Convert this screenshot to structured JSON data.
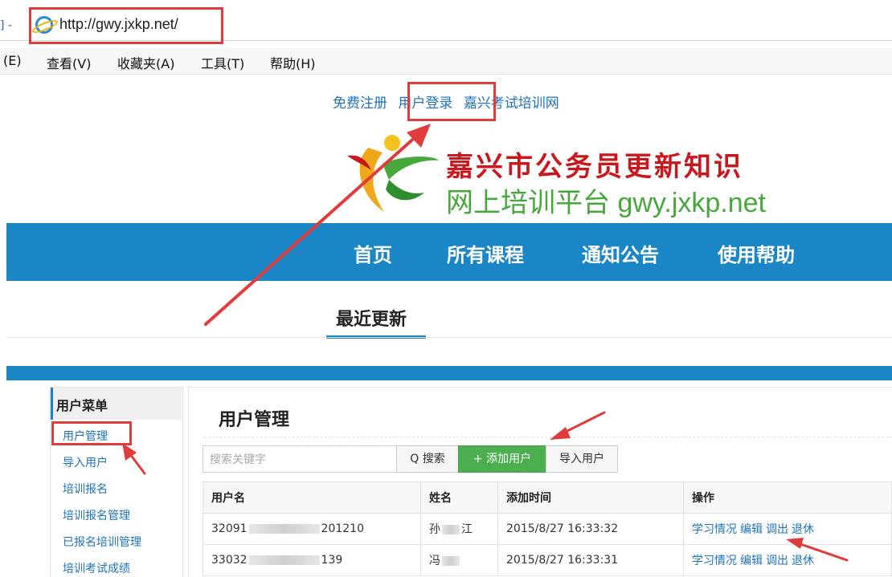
{
  "browser": {
    "nav_prefix": "] -",
    "url": "http://gwy.jxkp.net/",
    "menu": [
      "(E)",
      "查看(V)",
      "收藏夹(A)",
      "工具(T)",
      "帮助(H)"
    ]
  },
  "site": {
    "toplinks": [
      "免费注册",
      "用户登录",
      "嘉兴考试培训网"
    ],
    "logo_line1": "嘉兴市公务员更新知识",
    "logo_line2": "网上培训平台 gwy.jxkp.net",
    "nav": [
      "首页",
      "所有课程",
      "通知公告",
      "使用帮助"
    ],
    "section_tab": "最近更新"
  },
  "admin": {
    "sidebar_title": "用户菜单",
    "sidebar_items": [
      "用户管理",
      "导入用户",
      "培训报名",
      "培训报名管理",
      "已报名培训管理",
      "培训考试成绩"
    ],
    "page_title": "用户管理",
    "search_placeholder": "搜索关键字",
    "search_button": "Q 搜索",
    "add_button": "+ 添加用户",
    "import_button": "导入用户",
    "table": {
      "headers": [
        "用户名",
        "姓名",
        "添加时间",
        "操作"
      ],
      "rows": [
        {
          "username_start": "32091",
          "username_end": "201210",
          "name_start": "孙",
          "name_end": "江",
          "added": "2015/8/27 16:33:32"
        },
        {
          "username_start": "33032",
          "username_end": "139",
          "name_start": "冯",
          "name_end": "",
          "added": "2015/8/27 16:33:31"
        }
      ],
      "actions": [
        "学习情况",
        "编辑",
        "调出",
        "退休"
      ]
    }
  },
  "colors": {
    "accent_blue": "#1b86c6",
    "highlight_red": "#e03c3c",
    "button_green": "#4bae4f",
    "link_blue": "#1e73bd"
  }
}
